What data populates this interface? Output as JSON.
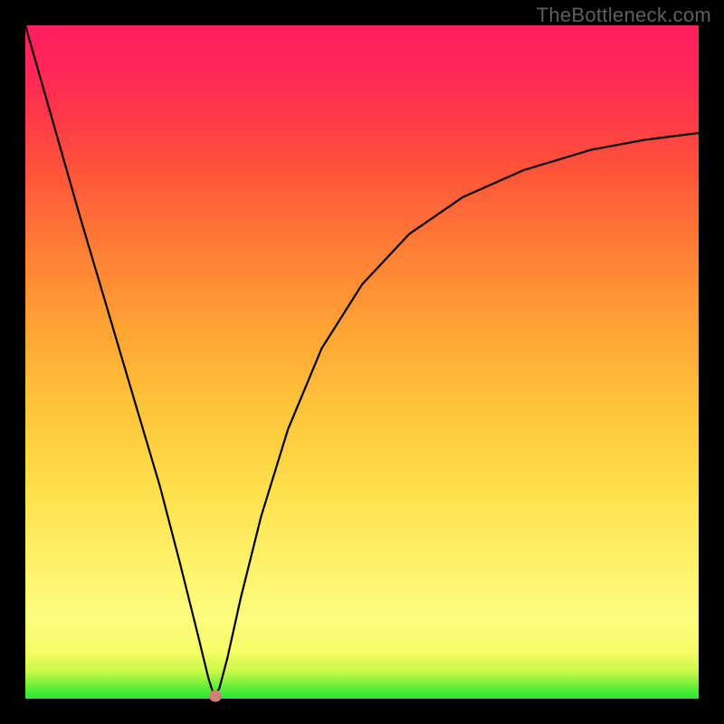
{
  "watermark": "TheBottleneck.com",
  "chart_data": {
    "type": "line",
    "title": "",
    "xlabel": "",
    "ylabel": "",
    "xlim": [
      0,
      100
    ],
    "ylim": [
      0,
      100
    ],
    "grid": false,
    "legend": false,
    "gradient_stops": [
      {
        "pos": 0,
        "color": "#27e833"
      },
      {
        "pos": 2,
        "color": "#6fef3a"
      },
      {
        "pos": 4,
        "color": "#c8f84a"
      },
      {
        "pos": 7,
        "color": "#f6fd66"
      },
      {
        "pos": 12,
        "color": "#fdfc80"
      },
      {
        "pos": 20,
        "color": "#fef26a"
      },
      {
        "pos": 32,
        "color": "#ffde4a"
      },
      {
        "pos": 44,
        "color": "#ffc23a"
      },
      {
        "pos": 56,
        "color": "#ffa034"
      },
      {
        "pos": 68,
        "color": "#ff7a36"
      },
      {
        "pos": 78,
        "color": "#ff5539"
      },
      {
        "pos": 86,
        "color": "#ff3a48"
      },
      {
        "pos": 92,
        "color": "#ff2a56"
      },
      {
        "pos": 100,
        "color": "#ff1f60"
      }
    ],
    "series": [
      {
        "name": "bottleneck-curve",
        "x": [
          0.0,
          4.0,
          8.0,
          12.0,
          16.0,
          20.0,
          23.0,
          25.5,
          27.2,
          28.0,
          28.8,
          30.0,
          32.0,
          35.0,
          39.0,
          44.0,
          50.0,
          57.0,
          65.0,
          74.0,
          84.0,
          92.0,
          100.0
        ],
        "y": [
          100.0,
          86.0,
          72.0,
          58.5,
          45.0,
          31.5,
          20.0,
          10.0,
          3.0,
          0.5,
          1.5,
          6.0,
          15.0,
          27.0,
          40.0,
          52.0,
          61.5,
          69.0,
          74.5,
          78.5,
          81.5,
          83.0,
          84.0
        ]
      }
    ],
    "marker": {
      "x": 28.2,
      "y": 0.4,
      "color": "#cb8277"
    }
  }
}
